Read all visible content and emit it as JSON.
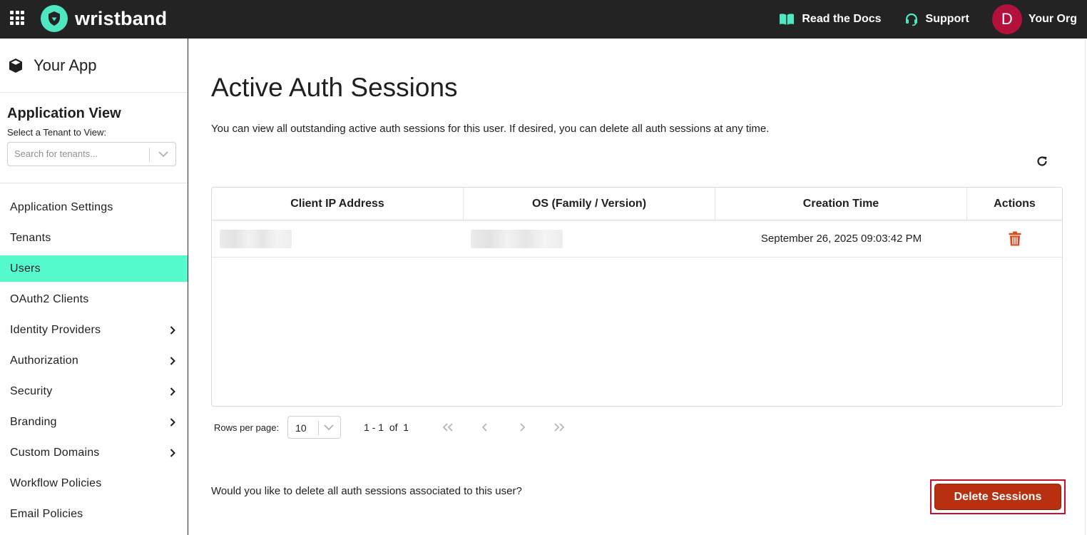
{
  "topbar": {
    "brand": "wristband",
    "docs_label": "Read the Docs",
    "support_label": "Support",
    "avatar_initial": "D",
    "org_name": "Your Org",
    "accent_color": "#4fe6c2",
    "avatar_color": "#b3113c"
  },
  "sidebar": {
    "app_name": "Your App",
    "app_view_title": "Application View",
    "tenant_select_label": "Select a Tenant to View:",
    "tenant_search_placeholder": "Search for tenants...",
    "active_color": "#56fbcd",
    "items": [
      {
        "label": "Application Settings",
        "has_children": false,
        "active": false
      },
      {
        "label": "Tenants",
        "has_children": false,
        "active": false
      },
      {
        "label": "Users",
        "has_children": false,
        "active": true
      },
      {
        "label": "OAuth2 Clients",
        "has_children": false,
        "active": false
      },
      {
        "label": "Identity Providers",
        "has_children": true,
        "active": false
      },
      {
        "label": "Authorization",
        "has_children": true,
        "active": false
      },
      {
        "label": "Security",
        "has_children": true,
        "active": false
      },
      {
        "label": "Branding",
        "has_children": true,
        "active": false
      },
      {
        "label": "Custom Domains",
        "has_children": true,
        "active": false
      },
      {
        "label": "Workflow Policies",
        "has_children": false,
        "active": false
      },
      {
        "label": "Email Policies",
        "has_children": false,
        "active": false
      }
    ]
  },
  "main": {
    "title": "Active Auth Sessions",
    "description": "You can view all outstanding active auth sessions for this user. If desired, you can delete all auth sessions at any time.",
    "table": {
      "columns": [
        "Client IP Address",
        "OS (Family / Version)",
        "Creation Time",
        "Actions"
      ],
      "rows": [
        {
          "creation_time": "September 26, 2025 09:03:42 PM"
        }
      ]
    },
    "pagination": {
      "rows_per_page_label": "Rows per page:",
      "rows_per_page_value": "10",
      "range_text": "1 - 1  of  1"
    },
    "delete_prompt": "Would you like to delete all auth sessions associated to this user?",
    "delete_button_label": "Delete Sessions",
    "delete_color": "#b8300f"
  }
}
